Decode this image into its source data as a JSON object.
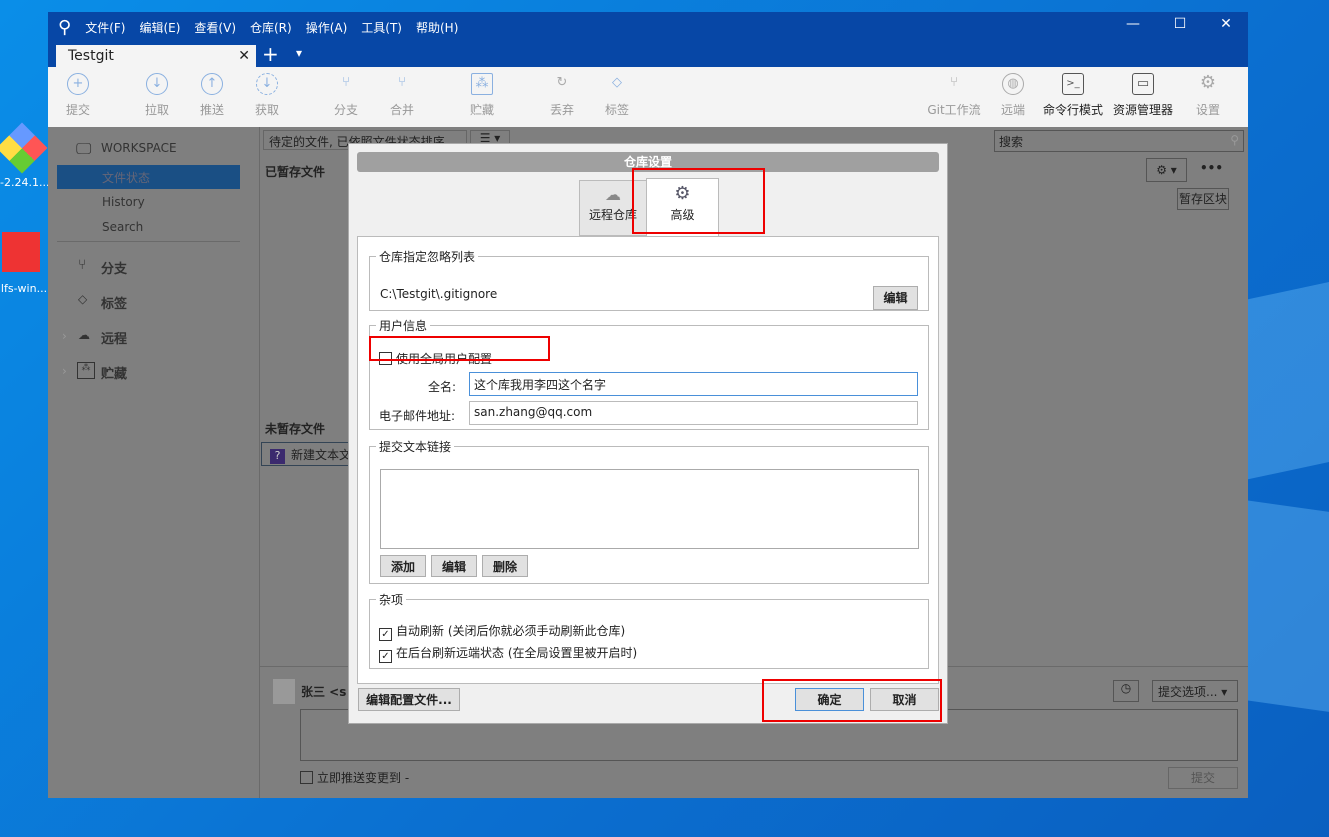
{
  "desktop": {
    "icons": [
      "-2.24.1...",
      "lfs-win..."
    ]
  },
  "menu": [
    "文件(F)",
    "编辑(E)",
    "查看(V)",
    "仓库(R)",
    "操作(A)",
    "工具(T)",
    "帮助(H)"
  ],
  "window_controls": {
    "minimize": "—",
    "maximize": "☐",
    "close": "✕"
  },
  "tab": {
    "title": "Testgit",
    "close": "✕",
    "add": "+",
    "dropdown": "▾"
  },
  "toolbar": {
    "left": [
      {
        "label": "提交",
        "icon": "+"
      },
      {
        "label": "拉取",
        "icon": "↓"
      },
      {
        "label": "推送",
        "icon": "↑"
      },
      {
        "label": "获取",
        "icon": "↓"
      },
      {
        "label": "分支",
        "icon": "⑂"
      },
      {
        "label": "合并",
        "icon": "⑂"
      },
      {
        "label": "贮藏",
        "icon": "⁂"
      },
      {
        "label": "丢弃",
        "icon": "↻"
      },
      {
        "label": "标签",
        "icon": "◇"
      }
    ],
    "right": [
      {
        "label": "Git工作流",
        "icon": "⑂"
      },
      {
        "label": "远端",
        "icon": "◍"
      },
      {
        "label": "命令行模式",
        "icon": ">_"
      },
      {
        "label": "资源管理器",
        "icon": "▭"
      },
      {
        "label": "设置",
        "icon": "⚙"
      }
    ]
  },
  "sidebar": {
    "workspace": "WORKSPACE",
    "items": [
      "文件状态",
      "History",
      "Search"
    ],
    "sections": [
      "分支",
      "标签",
      "远程",
      "贮藏"
    ]
  },
  "main": {
    "filter": "待定的文件, 已依照文件状态排序",
    "search_placeholder": "搜索",
    "staged": "已暂存文件",
    "unstaged": "未暂存文件",
    "stage_hunk": "暂存区块",
    "file": "新建文本文",
    "author": "张三 <s",
    "push_now": "立即推送变更到 -",
    "commit": "提交",
    "commit_options": "提交选项..."
  },
  "dialog": {
    "title": "仓库设置",
    "tabs": [
      "远程仓库",
      "高级"
    ],
    "ignore": {
      "legend": "仓库指定忽略列表",
      "path": "C:\\Testgit\\.gitignore",
      "edit": "编辑"
    },
    "user": {
      "legend": "用户信息",
      "use_global": "使用全局用户配置",
      "use_global_checked": false,
      "name_label": "全名:",
      "name": "这个库我用李四这个名字",
      "email_label": "电子邮件地址:",
      "email": "san.zhang@qq.com"
    },
    "links": {
      "legend": "提交文本链接",
      "add": "添加",
      "edit": "编辑",
      "delete": "删除"
    },
    "misc": {
      "legend": "杂项",
      "auto_refresh": "自动刷新 (关闭后你就必须手动刷新此仓库)",
      "bg_refresh": "在后台刷新远端状态 (在全局设置里被开启时)",
      "auto_refresh_checked": true,
      "bg_refresh_checked": true
    },
    "edit_config": "编辑配置文件...",
    "ok": "确定",
    "cancel": "取消"
  }
}
